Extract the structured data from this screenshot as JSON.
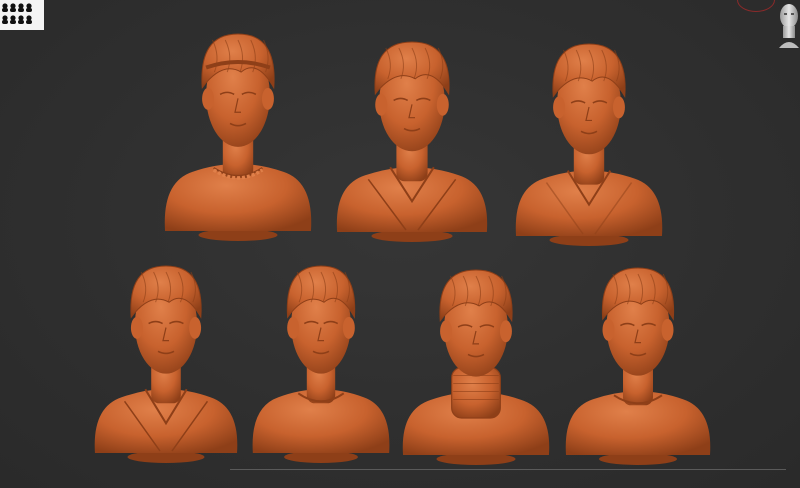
{
  "viewport": {
    "background_color": "#2e2e2e",
    "clay_color": "#c8622e",
    "clay_shadow_color": "#8e3f18",
    "clay_highlight_color": "#e0804a"
  },
  "toolbar": {
    "subtool_thumbnail_icon": "subtool-thumbnail-icon",
    "axis_head_icon": "axis-head-icon"
  },
  "models": [
    {
      "id": "bust-1",
      "style": "crew-neck with chain necklace, headband"
    },
    {
      "id": "bust-2",
      "style": "blazer over collared shirt"
    },
    {
      "id": "bust-3",
      "style": "smiling, open-collar shirt"
    },
    {
      "id": "bust-4",
      "style": "jacket over collared shirt"
    },
    {
      "id": "bust-5",
      "style": "crew-neck t-shirt"
    },
    {
      "id": "bust-6",
      "style": "turtleneck with jacket"
    },
    {
      "id": "bust-7",
      "style": "crew-neck t-shirt"
    }
  ]
}
